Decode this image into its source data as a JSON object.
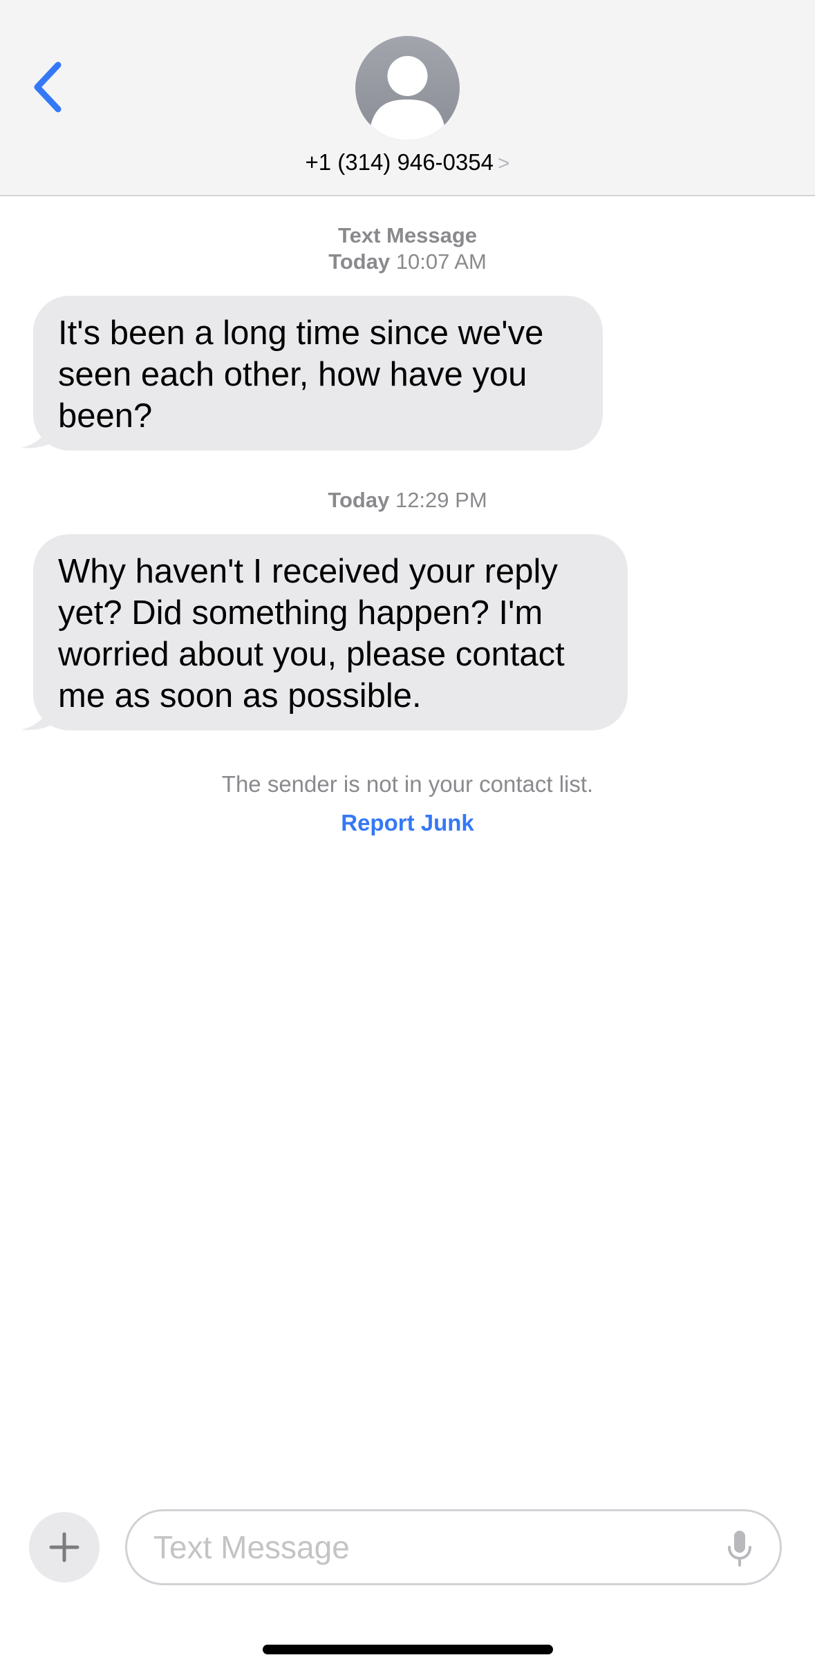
{
  "header": {
    "back_icon": "chevron-left-icon",
    "avatar_icon": "person-silhouette-icon",
    "contact_name": "+1 (314) 946-0354",
    "contact_chevron": ">"
  },
  "conversation": {
    "service_label": "Text Message",
    "first_stamp": {
      "day": "Today",
      "time": "10:07 AM"
    },
    "second_stamp": {
      "day": "Today",
      "time": "12:29 PM"
    },
    "messages": [
      {
        "direction": "incoming",
        "text": "It's been a long time since we've seen each other, how have you been?"
      },
      {
        "direction": "incoming",
        "text": "Why haven't I received your reply yet? Did something happen? I'm worried about you, please contact me as soon as possible."
      }
    ],
    "unknown_sender_notice": "The sender is not in your contact list.",
    "report_junk_label": "Report Junk"
  },
  "composer": {
    "plus_icon": "plus-icon",
    "placeholder": "Text Message",
    "value": "",
    "mic_icon": "microphone-icon"
  },
  "colors": {
    "accent": "#3478f6",
    "incoming_bubble": "#e9e9eb",
    "header_bg": "#f4f4f5",
    "secondary_text": "#8a8a8e"
  }
}
